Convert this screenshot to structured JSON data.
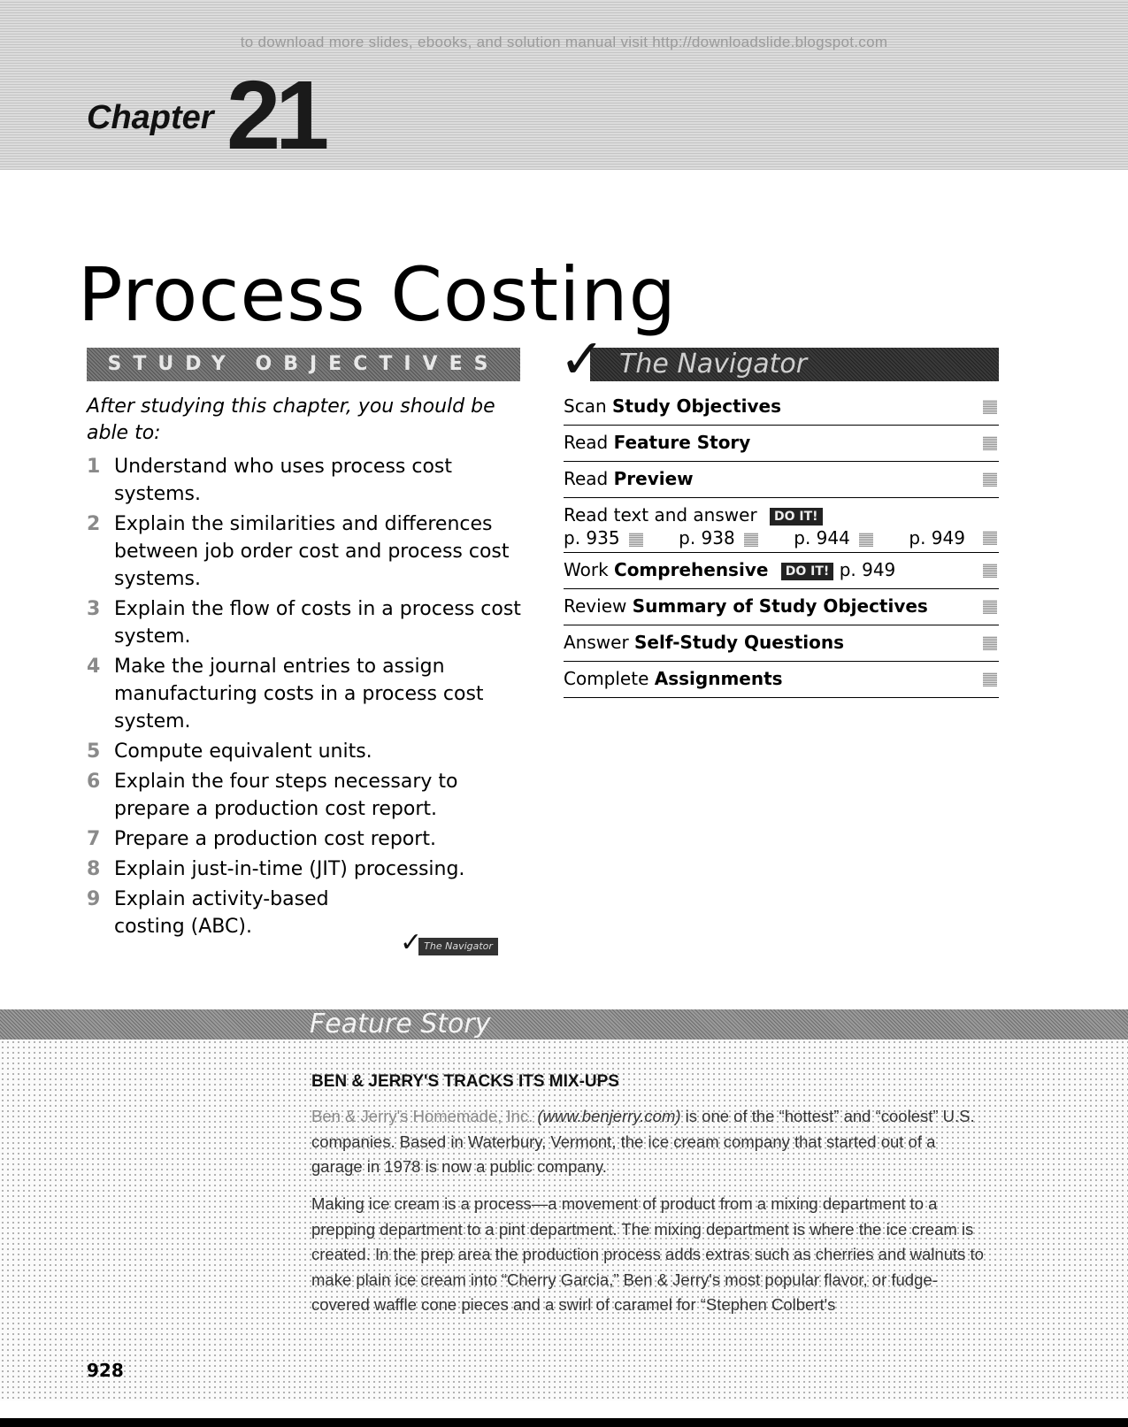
{
  "watermark": "to download more slides, ebooks, and solution manual visit http://downloadslide.blogspot.com",
  "chapter": {
    "label": "Chapter",
    "number": "21"
  },
  "title": "Process Costing",
  "study_objectives": {
    "heading": "STUDY OBJECTIVES",
    "intro": "After studying this chapter, you should be able to:",
    "items": [
      {
        "num": "1",
        "text": "Understand who uses process cost systems."
      },
      {
        "num": "2",
        "text": "Explain the similarities and differences between job order cost and process cost systems."
      },
      {
        "num": "3",
        "text": "Explain the flow of costs in a process cost system."
      },
      {
        "num": "4",
        "text": "Make the journal entries to assign manufacturing costs in a process cost system."
      },
      {
        "num": "5",
        "text": "Compute equivalent units."
      },
      {
        "num": "6",
        "text": "Explain the four steps necessary to prepare a production cost report."
      },
      {
        "num": "7",
        "text": "Prepare a production cost report."
      },
      {
        "num": "8",
        "text": "Explain just-in-time (JIT) processing."
      },
      {
        "num": "9",
        "text": "Explain activity-based costing (ABC)."
      }
    ],
    "mini_navigator_label": "The Navigator"
  },
  "navigator": {
    "heading": "The Navigator",
    "check_icon": "checkmark-icon",
    "doit_label": "DO IT!",
    "rows": [
      {
        "verb": "Scan",
        "object": "Study Objectives"
      },
      {
        "verb": "Read",
        "object": "Feature Story"
      },
      {
        "verb": "Read",
        "object": "Preview"
      },
      {
        "verb": "Read text and answer",
        "object": "",
        "pages": [
          "p. 935",
          "p. 938",
          "p. 944",
          "p. 949"
        ]
      },
      {
        "verb": "Work",
        "object": "Comprehensive",
        "suffix": "p. 949"
      },
      {
        "verb": "Review",
        "object": "Summary of Study Objectives"
      },
      {
        "verb": "Answer",
        "object": "Self-Study Questions"
      },
      {
        "verb": "Complete",
        "object": "Assignments"
      }
    ]
  },
  "feature_story": {
    "heading": "Feature Story",
    "headline": "BEN & JERRY'S TRACKS ITS MIX-UPS",
    "p1_company": "Ben & Jerry's Homemade, Inc.",
    "p1_url": "(www.benjerry.com)",
    "p1_rest": " is one of the “hottest” and “coolest” U.S. companies. Based in Waterbury, Vermont, the ice cream company that started out of a garage in 1978 is now a public company.",
    "p2": "Making ice cream is a process—a movement of product from a mixing department to a prepping department to a pint department. The mixing department is where the ice cream is created. In the prep area the production process adds extras such as cherries and walnuts to make plain ice cream into “Cherry Garcia,” Ben & Jerry's most popular flavor, or fudge-covered waffle cone pieces and a swirl of caramel for “Stephen Colbert's"
  },
  "page_number": "928"
}
